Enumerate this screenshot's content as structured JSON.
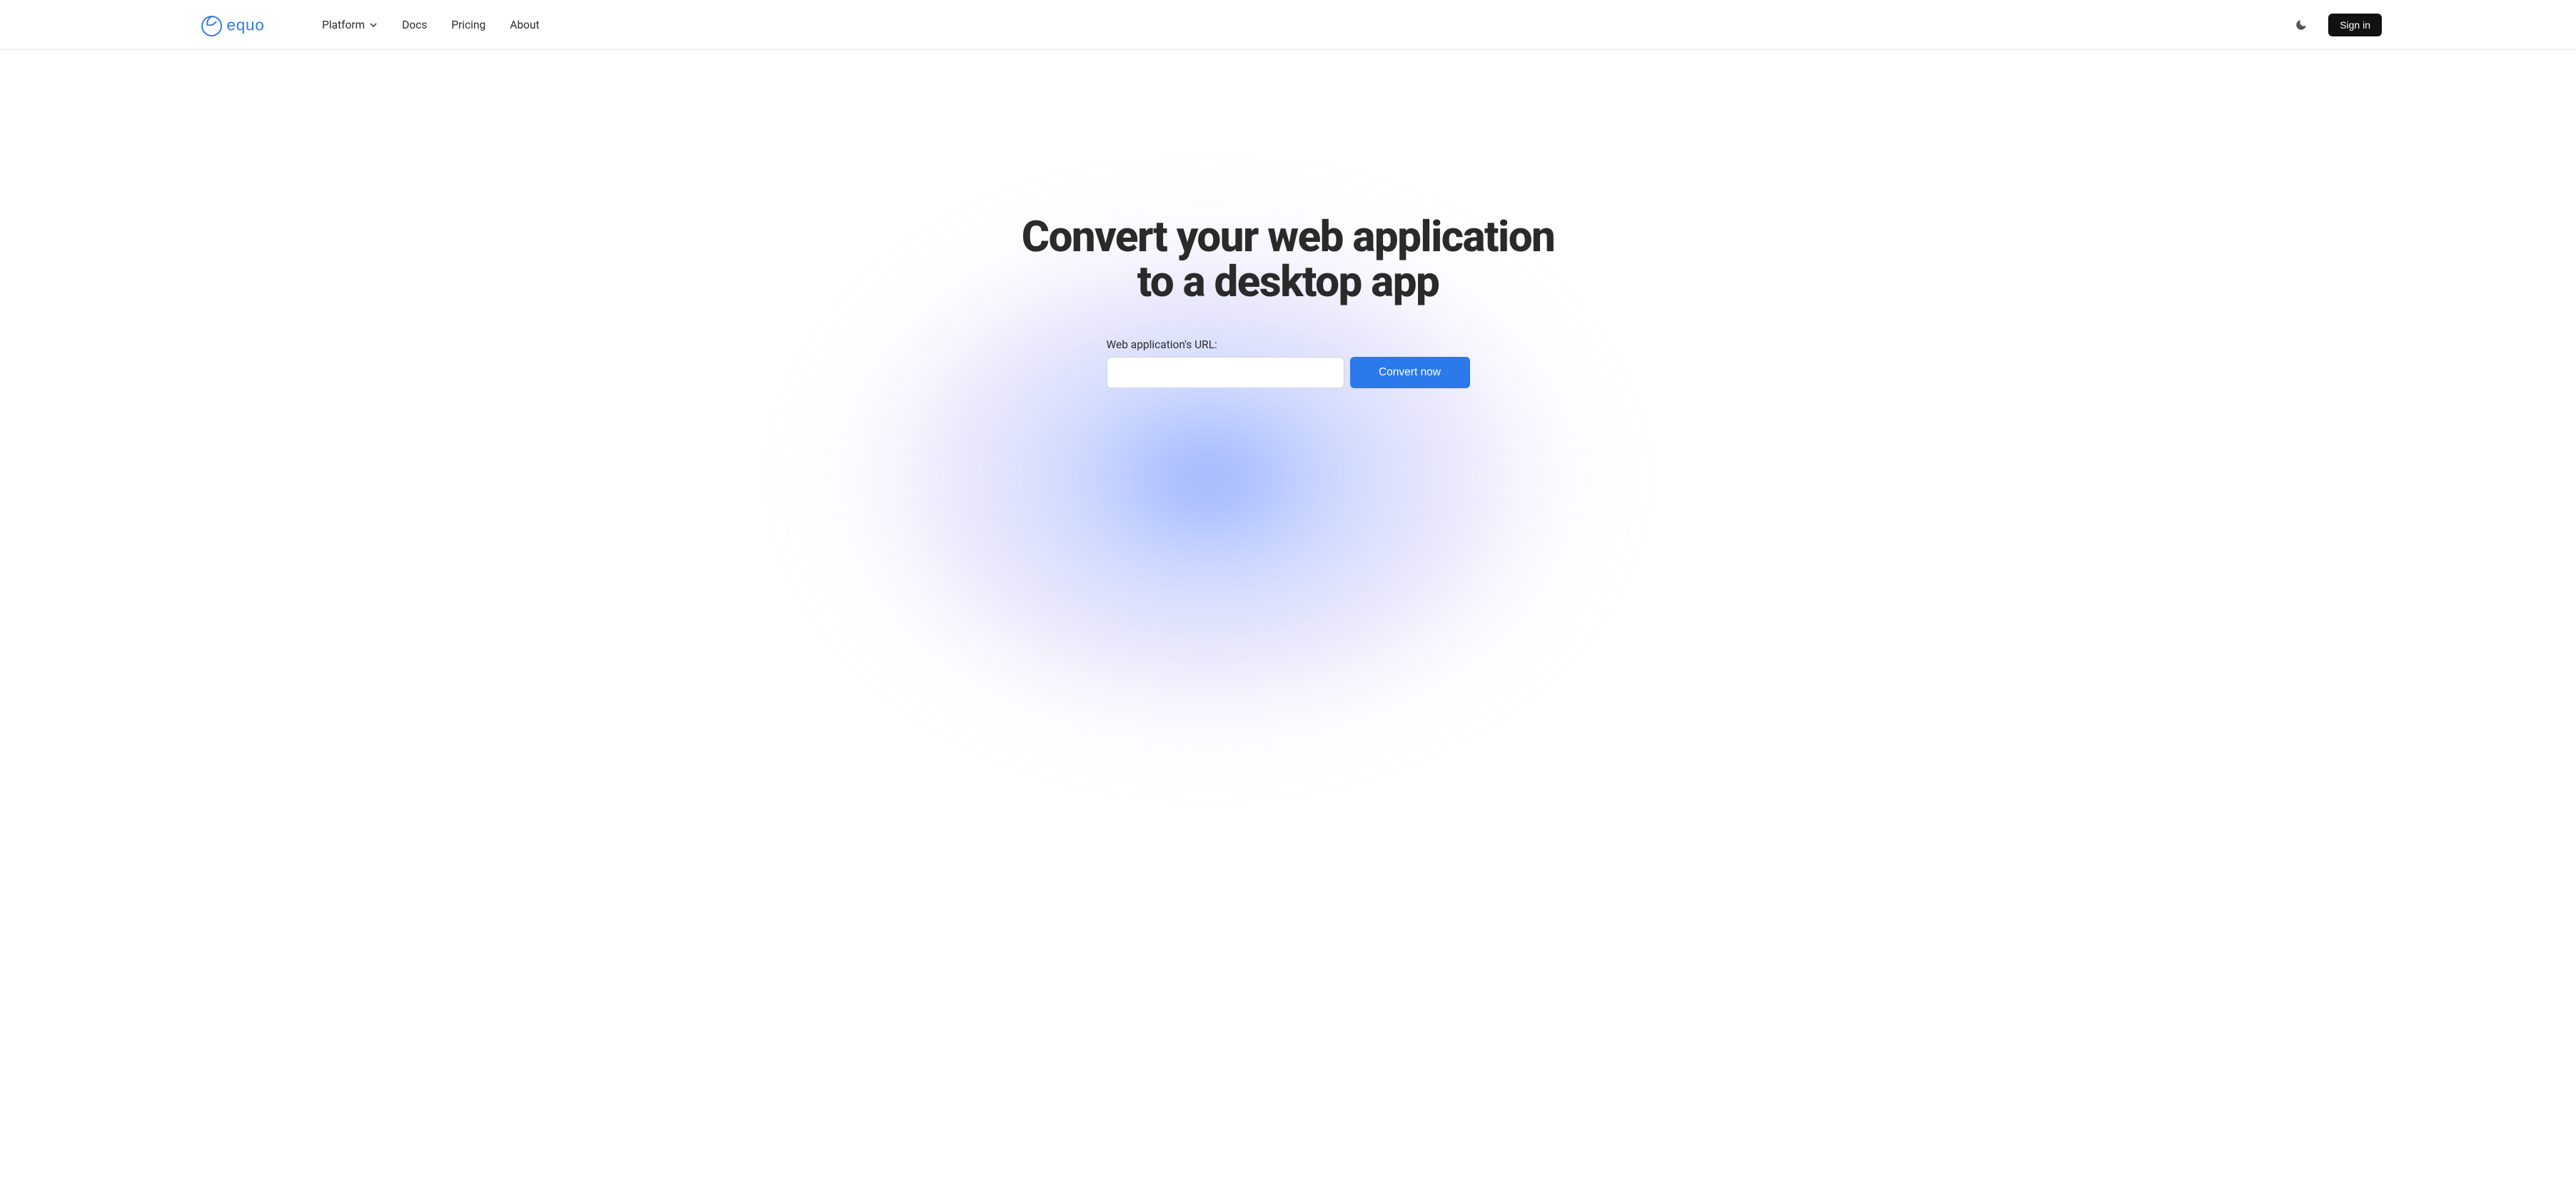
{
  "brand": {
    "name": "equo",
    "color": "#2b79ea"
  },
  "nav": {
    "platform": "Platform",
    "docs": "Docs",
    "pricing": "Pricing",
    "about": "About"
  },
  "header": {
    "sign_in": "Sign in"
  },
  "hero": {
    "title_line1": "Convert your web application",
    "title_line2": "to a desktop app",
    "form_label": "Web application's URL:",
    "input_value": "",
    "convert_button": "Convert now"
  }
}
